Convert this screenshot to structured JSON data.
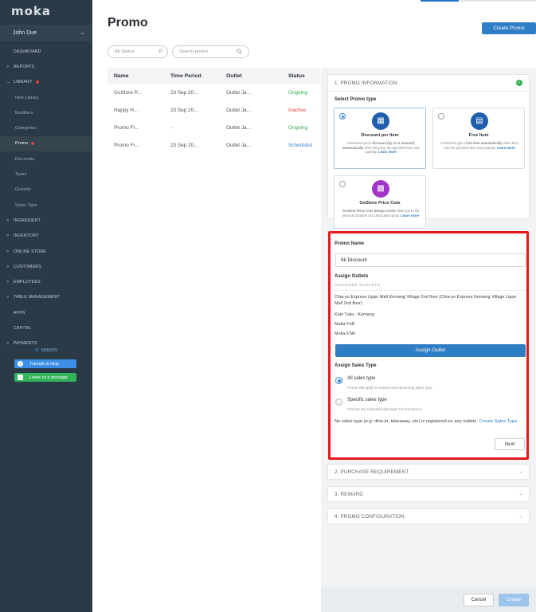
{
  "app": {
    "logo": "moka"
  },
  "user": {
    "name": "John Due",
    "chevron": "⌄"
  },
  "sidebar": {
    "items": [
      {
        "label": "DASHBOARD",
        "caret": ""
      },
      {
        "label": "REPORTS",
        "caret": ">"
      },
      {
        "label": "LIBRARY",
        "caret": "⌄"
      },
      {
        "label": "Item Library",
        "caret": ""
      },
      {
        "label": "Modifiers",
        "caret": ""
      },
      {
        "label": "Categories",
        "caret": ""
      },
      {
        "label": "Promo",
        "caret": ""
      },
      {
        "label": "Discounts",
        "caret": ""
      },
      {
        "label": "Taxes",
        "caret": ""
      },
      {
        "label": "Gratuity",
        "caret": ""
      },
      {
        "label": "Sales Type",
        "caret": ""
      },
      {
        "label": "INGREDIENT",
        "caret": ">"
      },
      {
        "label": "INVENTORY",
        "caret": ">"
      },
      {
        "label": "ONLINE STORE",
        "caret": ">"
      },
      {
        "label": "CUSTOMERS",
        "caret": ">"
      },
      {
        "label": "EMPLOYEES",
        "caret": ">"
      },
      {
        "label": "TABLE MANAGEMENT",
        "caret": ">"
      },
      {
        "label": "APPS",
        "caret": ""
      },
      {
        "label": "CAPITAL",
        "caret": ""
      },
      {
        "label": "PAYMENTS",
        "caret": ">"
      }
    ],
    "phone": "1500970",
    "tutorials_label": "Tutorials & Help",
    "message_label": "Leave us a message"
  },
  "header": {
    "title": "Promo",
    "create_label": "Create Promo"
  },
  "filters": {
    "status_value": "All Status",
    "search_placeholder": "Search promo"
  },
  "table": {
    "columns": [
      "Name",
      "Time Period",
      "Outlet",
      "Status"
    ],
    "rows": [
      {
        "name": "GoStore P...",
        "period": "23 Sep 20...",
        "outlet": "Outlet Ja...",
        "status": "Ongoing"
      },
      {
        "name": "Happy H...",
        "period": "23 Sep 20...",
        "outlet": "Outlet Ja...",
        "status": "Inactive"
      },
      {
        "name": "Promo Fr...",
        "period": "-",
        "outlet": "Outlet Ja...",
        "status": "Ongoing"
      },
      {
        "name": "Promo Fr...",
        "period": "23 Sep 20...",
        "outlet": "Outlet Ja...",
        "status": "Scheduled"
      }
    ]
  },
  "status_colors": {
    "Ongoing": "#2fa84f",
    "Inactive": "#e0413e",
    "Scheduled": "#3b82d4"
  },
  "promo_info": {
    "title": "1. PROMO INFORMATION",
    "select_type_label": "Select Promo type",
    "types": [
      {
        "name": "Discount per Item",
        "desc_pre": "Customers get a ",
        "desc_bold": "discount (by % or amount) automatically",
        "desc_post": " when they buy the specified item and quantity. ",
        "link": "Learn more"
      },
      {
        "name": "Free Item",
        "desc_pre": "Customers get a ",
        "desc_bold": "free item automatically",
        "desc_post": " when they buy the specified item and quantity. ",
        "link": "Learn more"
      },
      {
        "name": "GoStore Price Cuts",
        "desc_pre": "",
        "desc_bold": "GoStore Price Cuts (Harga Coret)",
        "desc_post": " allow you to list items at GoStore at a discounted price. ",
        "link": "Learn more"
      }
    ]
  },
  "promo_form": {
    "name_label": "Promo Name",
    "name_value": "5k Discount",
    "assign_outlets_label": "Assign Outlets",
    "assigned_header": "ASSIGNED OUTLETS",
    "outlets": [
      "Chia-yo Express Lippo Mall Kemang Village 2nd floor (Chia-yo Express Kemang Village Lippo Mall 2nd floor)",
      "Kopi Tuku - Kemang",
      "Moka FnB",
      "Moka FSR"
    ],
    "assign_outlet_button": "Assign Outlet",
    "sales_type_label": "Assign Sales Type",
    "sales_options": [
      {
        "label": "All sales type",
        "hint": "Promo will apply to current and upcoming sales type.",
        "selected": true
      },
      {
        "label": "Specific sales type",
        "hint": "Choose the selected sales type for this promo.",
        "selected": false
      }
    ],
    "no_sales_text": "No sales type (e.g: dine-in, takeaway, etc) is registered on any outlets.",
    "create_sales_link": "Create Sales Type",
    "next_label": "Next"
  },
  "sections": [
    {
      "title": "2. PURCHASE REQUIREMENT"
    },
    {
      "title": "3. REWARD"
    },
    {
      "title": "4. PROMO CONFIGURATION"
    }
  ],
  "footer": {
    "cancel_label": "Cancel",
    "create_label": "Create"
  }
}
